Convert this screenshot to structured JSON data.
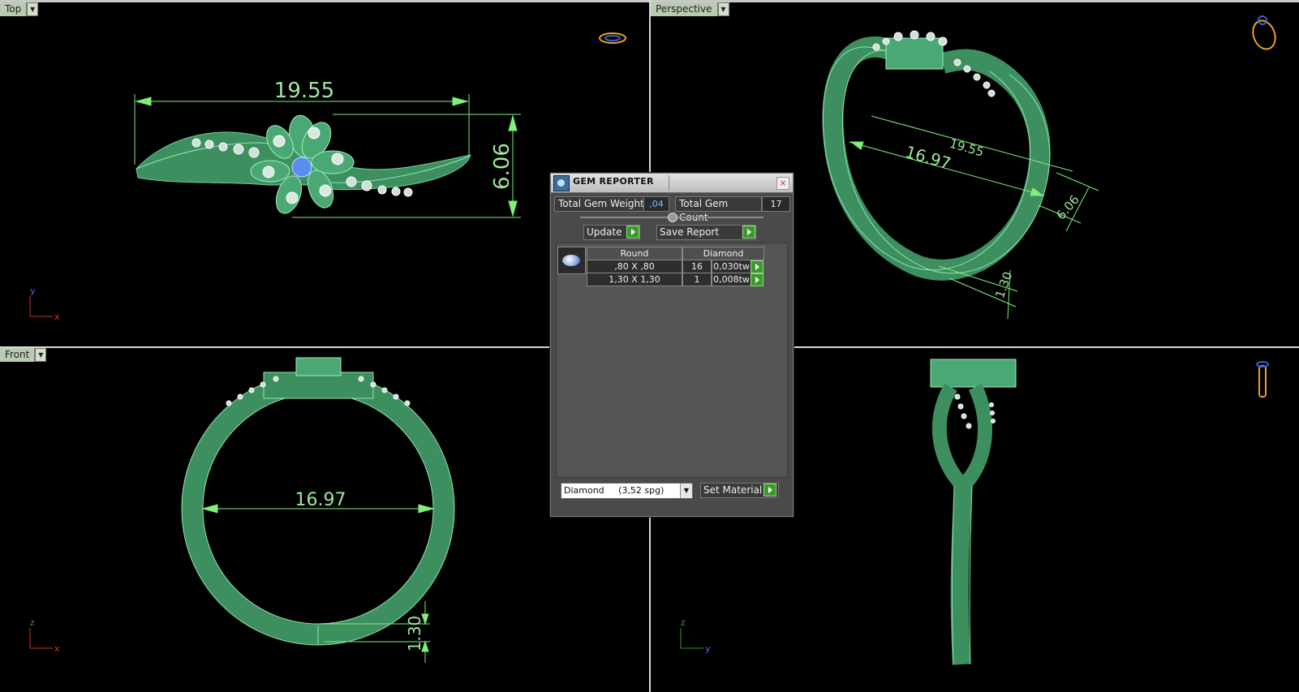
{
  "viewports": {
    "top": {
      "label": "Top",
      "axis_h": "x",
      "axis_v": "y",
      "dim_width": "19.55",
      "dim_height": "6.06"
    },
    "perspective": {
      "label": "Perspective",
      "dim_a": "19.55",
      "dim_b": "16.97",
      "dim_c": "6.06",
      "dim_d": "1.30"
    },
    "front": {
      "label": "Front",
      "axis_h": "x",
      "axis_v": "z",
      "dim_diameter": "16.97",
      "dim_thickness": "1.30"
    },
    "right": {
      "axis_h": "y",
      "axis_v": "z"
    }
  },
  "gem_reporter": {
    "title": "GEM REPORTER",
    "close_icon": "close-icon",
    "total_weight_label": "Total Gem Weight",
    "total_weight_value": ",04",
    "total_count_label": "Total Gem Count",
    "total_count_value": "17",
    "update_label": "Update",
    "save_report_label": "Save Report",
    "table": {
      "headers": [
        "Round",
        "Diamond"
      ],
      "rows": [
        {
          "size": ",80 X ,80",
          "count": "16",
          "weight": "0,030tw"
        },
        {
          "size": "1,30 X 1,30",
          "count": "1",
          "weight": "0,008tw"
        }
      ]
    },
    "material_select": "Diamond     (3,52 spg)",
    "set_material_label": "Set Material"
  },
  "colors": {
    "model": "#4fa872",
    "dimension": "#7ff07a",
    "accent_green": "#3c9a2d"
  }
}
